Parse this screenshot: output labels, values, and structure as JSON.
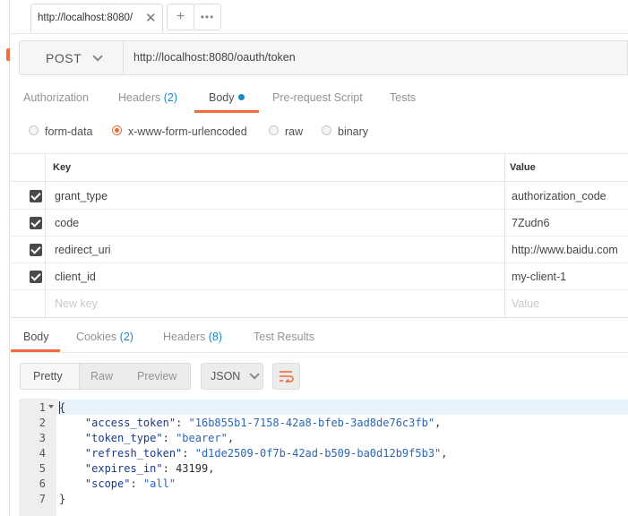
{
  "tabbar": {
    "tab_title": "http://localhost:8080/",
    "close_glyph": "✕",
    "add_glyph": "+",
    "more_glyph": "•••"
  },
  "request": {
    "method": "POST",
    "url": "http://localhost:8080/oauth/token"
  },
  "request_tabs": [
    {
      "label": "Authorization",
      "count": ""
    },
    {
      "label": "Headers",
      "count": "(2)"
    },
    {
      "label": "Body",
      "count": ""
    },
    {
      "label": "Pre-request Script",
      "count": ""
    },
    {
      "label": "Tests",
      "count": ""
    }
  ],
  "body_modes": [
    {
      "label": "form-data",
      "selected": false
    },
    {
      "label": "x-www-form-urlencoded",
      "selected": true
    },
    {
      "label": "raw",
      "selected": false
    },
    {
      "label": "binary",
      "selected": false
    }
  ],
  "params_table": {
    "columns": [
      "Key",
      "Value"
    ],
    "rows": [
      {
        "key": "grant_type",
        "value": "authorization_code",
        "checked": true
      },
      {
        "key": "code",
        "value": "7Zudn6",
        "checked": true
      },
      {
        "key": "redirect_uri",
        "value": "http://www.baidu.com",
        "checked": true
      },
      {
        "key": "client_id",
        "value": "my-client-1",
        "checked": true
      }
    ],
    "new_key_placeholder": "New key",
    "new_value_placeholder": "Value"
  },
  "response_tabs": [
    {
      "label": "Body",
      "count": ""
    },
    {
      "label": "Cookies",
      "count": "(2)"
    },
    {
      "label": "Headers",
      "count": "(8)"
    },
    {
      "label": "Test Results",
      "count": ""
    }
  ],
  "view_modes": [
    "Pretty",
    "Raw",
    "Preview"
  ],
  "format": "JSON",
  "accent_color": "#f26b3a",
  "link_color": "#1b86c6",
  "response_lines": [
    {
      "num": "1",
      "text": "{"
    },
    {
      "num": "2",
      "key": "\"access_token\"",
      "value": "\"16b855b1-7158-42a8-bfeb-3ad8de76c3fb\"",
      "tail": ","
    },
    {
      "num": "3",
      "key": "\"token_type\"",
      "value": "\"bearer\"",
      "tail": ","
    },
    {
      "num": "4",
      "key": "\"refresh_token\"",
      "value": "\"d1de2509-0f7b-42ad-b509-ba0d12b9f5b3\"",
      "tail": ","
    },
    {
      "num": "5",
      "key": "\"expires_in\"",
      "value": "43199",
      "tail": ","
    },
    {
      "num": "6",
      "key": "\"scope\"",
      "value": "\"all\"",
      "tail": ""
    },
    {
      "num": "7",
      "text": "}"
    }
  ]
}
